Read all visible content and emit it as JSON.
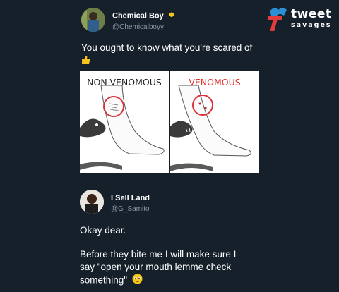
{
  "tweet1": {
    "name": "Chemical Boy",
    "handle": "@Chemicalboyy",
    "text": "You ought to know what you're scared of",
    "emoji_icon": "thumbs-up-icon"
  },
  "image": {
    "left_label": "NON-VENOMOUS",
    "right_label": "VENOMOUS",
    "label_colors": {
      "left": "#1f1f1f",
      "right": "#e0322f"
    },
    "circle_color": "#d9333a"
  },
  "tweet2": {
    "name": "I Sell Land",
    "handle": "@G_Samito",
    "reply": "Okay dear.",
    "line1": "Before they bite me I will make sure I",
    "line2": "say \"open your mouth lemme check",
    "line3": "something\"",
    "emoji_icon": "flushed-face-icon"
  },
  "brand": {
    "word1": "tweet",
    "word2": "savages",
    "accent": "#e23b3b",
    "secondary": "#2b8fd6"
  },
  "colors": {
    "background": "#15202b",
    "muted": "#8899a6"
  }
}
